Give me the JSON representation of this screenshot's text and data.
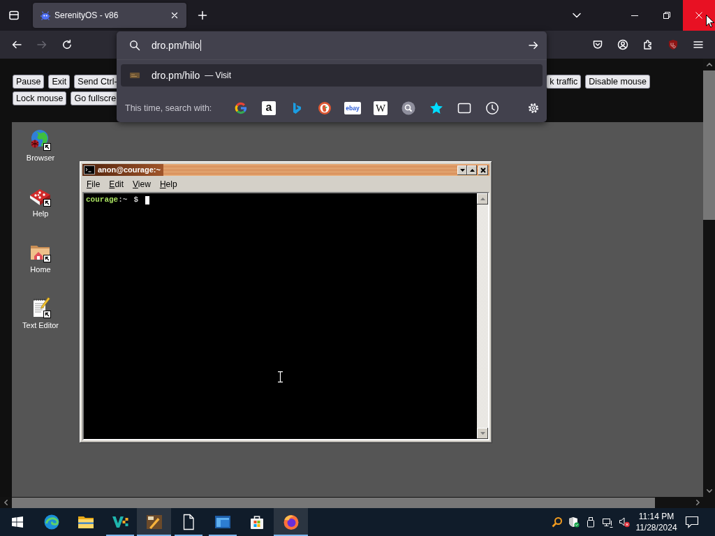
{
  "browser": {
    "tabs": [
      {
        "title": "SerenityOS - v86",
        "selected": true
      }
    ],
    "nav_buttons": [
      {
        "kind": "back",
        "disabled": false
      },
      {
        "kind": "forward",
        "disabled": true
      },
      {
        "kind": "reload",
        "disabled": false
      }
    ],
    "address_bar": {
      "value": "dro.pm/hilo"
    },
    "suggestions": [
      {
        "title": "dro.pm/hilo",
        "separator": "—",
        "action": "Visit",
        "selected": true
      }
    ],
    "search_with": {
      "label": "This time, search with:",
      "engines": [
        {
          "kind": "g_logo"
        },
        {
          "kind": "a_tile",
          "glyph": "a"
        },
        {
          "kind": "b_logo"
        },
        {
          "kind": "round_logo"
        },
        {
          "kind": "word_tile",
          "glyph": "ebay"
        },
        {
          "kind": "serif_tile",
          "glyph": "W"
        },
        {
          "kind": "magnifier"
        },
        {
          "kind": "star"
        },
        {
          "kind": "tab"
        },
        {
          "kind": "clock"
        }
      ]
    }
  },
  "page": {
    "button_rows": [
      {
        "left": [
          "Pause",
          "Exit",
          "Send Ctrl-"
        ],
        "right": [
          "k traffic",
          "Disable mouse"
        ]
      },
      {
        "left": [
          "Lock mouse",
          "Go fullscre"
        ]
      }
    ]
  },
  "desktop": {
    "shortcuts": [
      {
        "label": "Browser",
        "kind": "globe"
      },
      {
        "label": "Help",
        "kind": "book"
      },
      {
        "label": "Home",
        "kind": "home_folder"
      },
      {
        "label": "Text Editor",
        "kind": "notepad"
      }
    ],
    "terminal": {
      "title": "anon@courage:~",
      "menus": [
        "File",
        "Edit",
        "View",
        "Help"
      ],
      "prompt": {
        "host": "courage",
        "cwd": ":~",
        "symbol": "$"
      }
    }
  },
  "taskbar": {
    "apps": [
      {
        "kind": "swirl",
        "running": false,
        "highlighted": false
      },
      {
        "kind": "folder",
        "running": false,
        "highlighted": false
      },
      {
        "kind": "v_logo",
        "running": true,
        "highlighted": false
      },
      {
        "kind": "brush",
        "running": true,
        "highlighted": true
      },
      {
        "kind": "document",
        "running": true,
        "highlighted": false
      },
      {
        "kind": "window",
        "running": true,
        "highlighted": false
      },
      {
        "kind": "bag",
        "running": false,
        "highlighted": false
      },
      {
        "kind": "fox",
        "running": true,
        "highlighted": true
      }
    ],
    "clock": {
      "time": "11:14 PM",
      "date": "11/28/2024"
    }
  }
}
